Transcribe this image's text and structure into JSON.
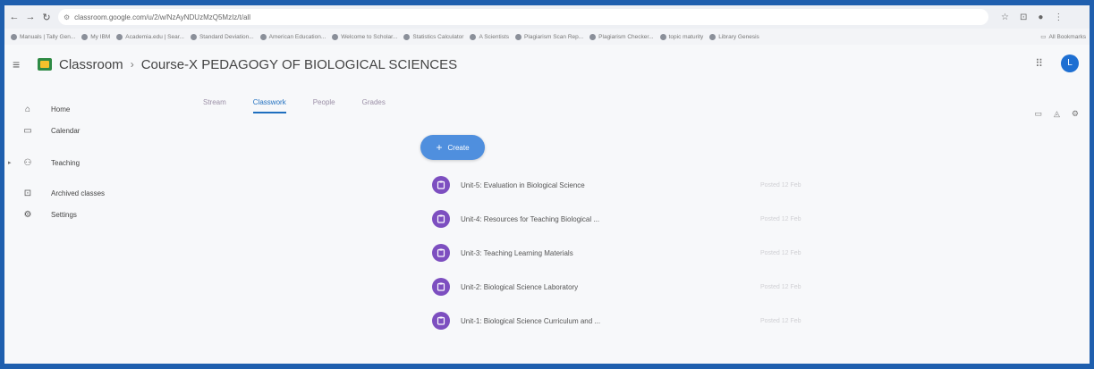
{
  "browser": {
    "url": "classroom.google.com/u/2/w/NzAyNDUzMzQ5MzIz/t/all",
    "nav_icons": [
      "back-icon",
      "forward-icon",
      "reload-icon"
    ],
    "bookmarks": [
      "Manuals | Tally Gen...",
      "My IBM",
      "Academia.edu | Sear...",
      "Standard Deviation...",
      "American Education...",
      "Welcome to Scholar...",
      "Statistics Calculator",
      "A Scientists",
      "Plagiarism Scan Rep...",
      "Plagiarism Checker...",
      "topic maturity",
      "Library Genesis"
    ],
    "all_bookmarks": "All Bookmarks"
  },
  "header": {
    "app_name": "Classroom",
    "separator": "›",
    "course_title": "Course-X PEDAGOGY OF BIOLOGICAL SCIENCES",
    "avatar_initial": "L"
  },
  "sidebar": {
    "items": [
      {
        "label": "Home",
        "icon": "home-icon"
      },
      {
        "label": "Calendar",
        "icon": "calendar-icon"
      },
      {
        "label": "Teaching",
        "icon": "people-icon"
      },
      {
        "label": "Archived classes",
        "icon": "archive-icon"
      },
      {
        "label": "Settings",
        "icon": "gear-icon"
      }
    ]
  },
  "tabs": [
    {
      "label": "Stream"
    },
    {
      "label": "Classwork",
      "active": true
    },
    {
      "label": "People"
    },
    {
      "label": "Grades"
    }
  ],
  "create_label": "Create",
  "topics": [
    {
      "title": "Unit-5: Evaluation in Biological Science",
      "date": "Posted 12 Feb"
    },
    {
      "title": "Unit-4: Resources for Teaching Biological ...",
      "date": "Posted 12 Feb"
    },
    {
      "title": "Unit-3: Teaching Learning Materials",
      "date": "Posted 12 Feb"
    },
    {
      "title": "Unit-2: Biological Science Laboratory",
      "date": "Posted 12 Feb"
    },
    {
      "title": "Unit-1: Biological Science Curriculum and ...",
      "date": "Posted 12 Feb"
    }
  ],
  "colors": {
    "accent": "#1f6fbf",
    "create_button": "#4f8fde",
    "topic_icon": "#7d4fc0",
    "avatar": "#1e6fd2"
  }
}
